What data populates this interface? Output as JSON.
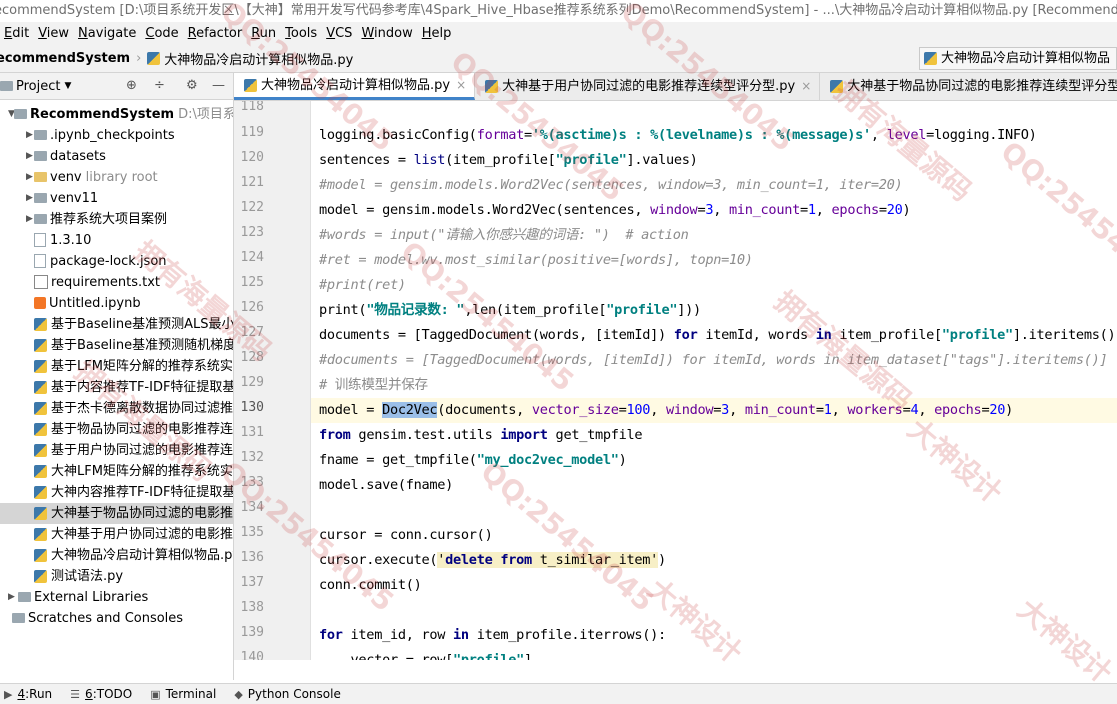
{
  "window": {
    "title": "ecommendSystem [D:\\项目系统开发区\\【大神】常用开发写代码参考库\\4Spark_Hive_Hbase推荐系统系列Demo\\RecommendSystem] - ...\\大神物品冷启动计算相似物品.py [RecommendSystem] - PyChar"
  },
  "menu": [
    "Edit",
    "View",
    "Navigate",
    "Code",
    "Refactor",
    "Run",
    "Tools",
    "VCS",
    "Window",
    "Help"
  ],
  "nav": {
    "project": "ecommendSystem",
    "file": "大神物品冷启动计算相似物品.py",
    "run_config": "大神物品冷启动计算相似物品"
  },
  "project_panel": {
    "title": "Project"
  },
  "tree": [
    {
      "label": "RecommendSystem",
      "extra": "D:\\项目系统开",
      "indent": 0,
      "kind": "folder",
      "arrow": "down",
      "bold": true
    },
    {
      "label": ".ipynb_checkpoints",
      "indent": 1,
      "kind": "folder",
      "arrow": "right"
    },
    {
      "label": "datasets",
      "indent": 1,
      "kind": "folder",
      "arrow": "right"
    },
    {
      "label": "venv",
      "extra": "library root",
      "indent": 1,
      "kind": "folder-y",
      "arrow": "right"
    },
    {
      "label": "venv11",
      "indent": 1,
      "kind": "folder",
      "arrow": "right"
    },
    {
      "label": "推荐系统大项目案例",
      "indent": 1,
      "kind": "folder",
      "arrow": "right"
    },
    {
      "label": "1.3.10",
      "indent": 1,
      "kind": "file"
    },
    {
      "label": "package-lock.json",
      "indent": 1,
      "kind": "file"
    },
    {
      "label": "requirements.txt",
      "indent": 1,
      "kind": "txt"
    },
    {
      "label": "Untitled.ipynb",
      "indent": 1,
      "kind": "nb"
    },
    {
      "label": "基于Baseline基准预测ALS最小二乘",
      "indent": 1,
      "kind": "py"
    },
    {
      "label": "基于Baseline基准预测随机梯度下降",
      "indent": 1,
      "kind": "py"
    },
    {
      "label": "基于LFM矩阵分解的推荐系统实现.",
      "indent": 1,
      "kind": "py"
    },
    {
      "label": "基于内容推荐TF-IDF特征提取基于",
      "indent": 1,
      "kind": "py"
    },
    {
      "label": "基于杰卡德离散数据协同过滤推荐",
      "indent": 1,
      "kind": "py"
    },
    {
      "label": "基于物品协同过滤的电影推荐连续",
      "indent": 1,
      "kind": "py"
    },
    {
      "label": "基于用户协同过滤的电影推荐连续",
      "indent": 1,
      "kind": "py"
    },
    {
      "label": "大神LFM矩阵分解的推荐系统实现.",
      "indent": 1,
      "kind": "py"
    },
    {
      "label": "大神内容推荐TF-IDF特征提取基于",
      "indent": 1,
      "kind": "py"
    },
    {
      "label": "大神基于物品协同过滤的电影推荐",
      "indent": 1,
      "kind": "py",
      "selected": true
    },
    {
      "label": "大神基于用户协同过滤的电影推荐",
      "indent": 1,
      "kind": "py"
    },
    {
      "label": "大神物品冷启动计算相似物品.py",
      "indent": 1,
      "kind": "py"
    },
    {
      "label": "测试语法.py",
      "indent": 1,
      "kind": "py"
    },
    {
      "label": "External Libraries",
      "indent": 0,
      "kind": "lib",
      "arrow": "right"
    },
    {
      "label": "Scratches and Consoles",
      "indent": 0,
      "kind": "scratch"
    }
  ],
  "tabs": [
    {
      "label": "大神物品冷启动计算相似物品.py",
      "active": true
    },
    {
      "label": "大神基于用户协同过滤的电影推荐连续型评分型.py",
      "active": false
    },
    {
      "label": "大神基于物品协同过滤的电影推荐连续型评分型.py",
      "active": false
    }
  ],
  "editor": {
    "line_numbers": [
      "118",
      "119",
      "120",
      "121",
      "122",
      "123",
      "124",
      "125",
      "126",
      "127",
      "128",
      "129",
      "130",
      "131",
      "132",
      "133",
      "134",
      "135",
      "136",
      "137",
      "138",
      "139",
      "140"
    ],
    "current_line": "130"
  },
  "bottom_tools": [
    {
      "num": "4",
      "label": "Run",
      "icon": "play-icon"
    },
    {
      "num": "6",
      "label": "TODO",
      "icon": "list-icon"
    },
    {
      "num": "",
      "label": "Terminal",
      "icon": "terminal-icon"
    },
    {
      "num": "",
      "label": "Python Console",
      "icon": "python-icon"
    }
  ],
  "watermarks": [
    "QQ:25454045",
    "拥有海量源码",
    "大神设计"
  ]
}
